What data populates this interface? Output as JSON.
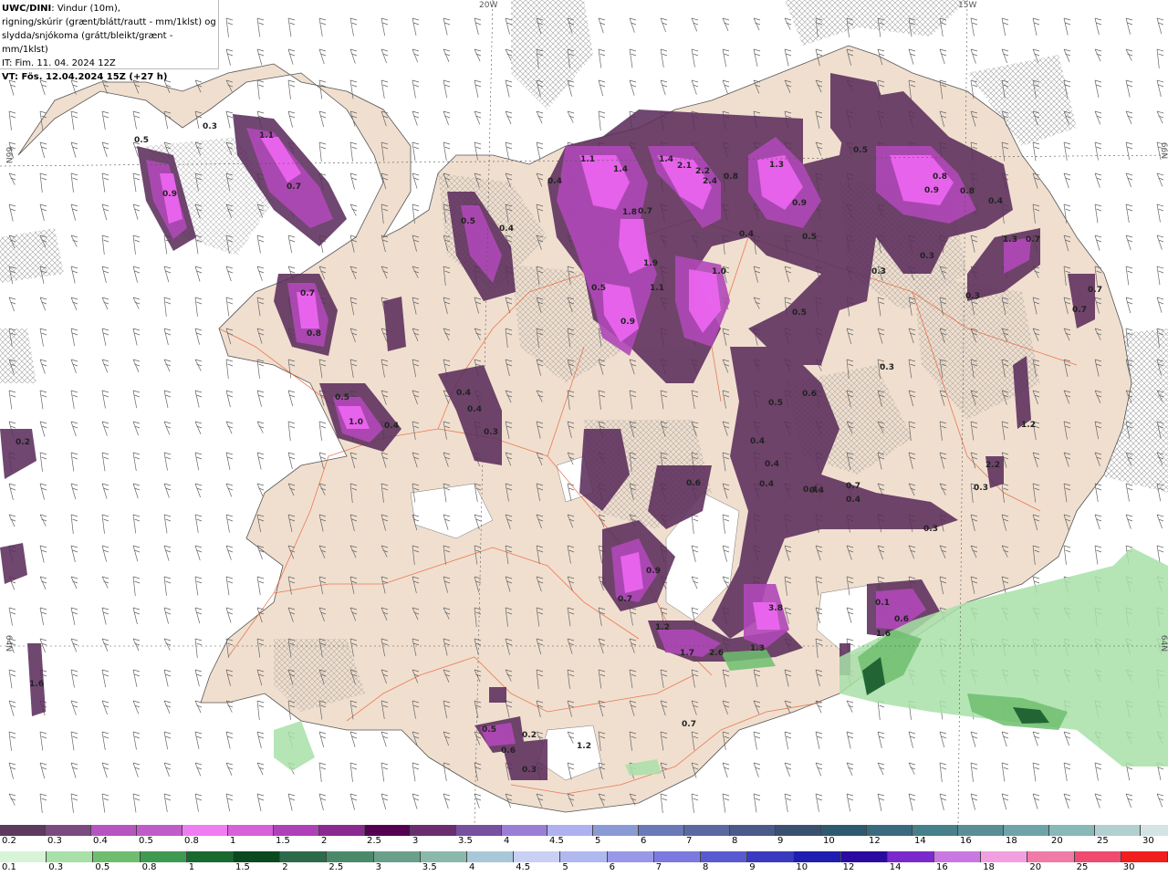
{
  "header": {
    "model": "UWC/DINI",
    "line1_rest": ": Vindur (10m),",
    "line2": "rigning/skúrir (grænt/blátt/rautt - mm/1klst) og",
    "line3": "slydda/snjókoma (grátt/bleikt/grænt - mm/1klst)",
    "line4": "IT: Fim. 11. 04. 2024 12Z",
    "line5": "VT: Fös. 12.04.2024 15Z (+27 h)"
  },
  "grid_labels": {
    "lon_20w": "20W",
    "lon_15w": "15W",
    "lat_66n_left": "66N",
    "lat_66n_right": "66N",
    "lat_64n_left": "64N",
    "lat_64n_right": "64N"
  },
  "colors": {
    "sea": "#ffffff",
    "land": "#f0dfcf",
    "roads": "#e8572a",
    "snow_light": "#5c2e5c",
    "snow_mid": "#b048b8",
    "snow_high": "#ee66f2",
    "rain_light": "#a8e0a8",
    "rain_mid": "#3e9a56",
    "rain_high": "#1a5a2e",
    "barbs": "#666666"
  },
  "legend_snow": {
    "ticks": [
      "0.2",
      "0.3",
      "0.4",
      "0.5",
      "0.8",
      "1",
      "1.5",
      "2",
      "2.5",
      "3",
      "3.5",
      "4",
      "4.5",
      "5",
      "6",
      "7",
      "8",
      "9",
      "10",
      "12",
      "14",
      "16",
      "18",
      "20",
      "25",
      "30"
    ],
    "colors": [
      "#5c3b5e",
      "#7a4a80",
      "#b654c0",
      "#c05cc8",
      "#f07cf2",
      "#d860d8",
      "#b040b8",
      "#8a2a90",
      "#560054",
      "#6a2e70",
      "#7850a0",
      "#9a7ed6",
      "#aeb0f0",
      "#8a9ad4",
      "#6a7ab8",
      "#5a6aa0",
      "#4a5a8a",
      "#3a5070",
      "#2e5a70",
      "#3a6a80",
      "#46808a",
      "#5a8e96",
      "#6ea4a8",
      "#88b8b8",
      "#b2d0d0",
      "#d4e4e4"
    ]
  },
  "legend_rain": {
    "ticks": [
      "0.1",
      "0.3",
      "0.5",
      "0.8",
      "1",
      "1.5",
      "2",
      "2.5",
      "3",
      "3.5",
      "4",
      "4.5",
      "5",
      "6",
      "7",
      "8",
      "9",
      "10",
      "12",
      "14",
      "16",
      "18",
      "20",
      "25",
      "30"
    ],
    "colors": [
      "#d8f4d8",
      "#a8e0a8",
      "#6fbe6f",
      "#3e9a50",
      "#1a6a30",
      "#0a4a1e",
      "#2e6a4a",
      "#4a8a6a",
      "#6aa08a",
      "#8ab8aa",
      "#a8c8d8",
      "#c8d0f4",
      "#b0b8f0",
      "#9898e8",
      "#7a7ae0",
      "#5a5ad0",
      "#3a3ac0",
      "#1e1eb0",
      "#2a0aa0",
      "#7a2acc",
      "#c878e0",
      "#f0a0e0",
      "#f07aa8",
      "#f04a70",
      "#f01e1e"
    ]
  },
  "precip_labels": [
    {
      "t": "0.3"
    },
    {
      "t": "1.1"
    },
    {
      "t": "0.7"
    },
    {
      "t": "0.5"
    },
    {
      "t": "0.9"
    },
    {
      "t": "0.7"
    },
    {
      "t": "0.8"
    },
    {
      "t": "1.0"
    },
    {
      "t": "0.4"
    },
    {
      "t": "0.5"
    },
    {
      "t": "0.4"
    },
    {
      "t": "0.4"
    },
    {
      "t": "0.3"
    },
    {
      "t": "0.5"
    },
    {
      "t": "0.4"
    },
    {
      "t": "0.2"
    },
    {
      "t": "1.1"
    },
    {
      "t": "1.4"
    },
    {
      "t": "1.4"
    },
    {
      "t": "2.1"
    },
    {
      "t": "2.2"
    },
    {
      "t": "2.4"
    },
    {
      "t": "1.8"
    },
    {
      "t": "1.9"
    },
    {
      "t": "1.1"
    },
    {
      "t": "1.0"
    },
    {
      "t": "0.9"
    },
    {
      "t": "0.5"
    },
    {
      "t": "0.4"
    },
    {
      "t": "1.3"
    },
    {
      "t": "0.9"
    },
    {
      "t": "0.7"
    },
    {
      "t": "0.4"
    },
    {
      "t": "0.5"
    },
    {
      "t": "0.5"
    },
    {
      "t": "0.8"
    },
    {
      "t": "0.9"
    },
    {
      "t": "0.8"
    },
    {
      "t": "0.8"
    },
    {
      "t": "0.4"
    },
    {
      "t": "0.3"
    },
    {
      "t": "0.3"
    },
    {
      "t": "0.7"
    },
    {
      "t": "0.3"
    },
    {
      "t": "0.5"
    },
    {
      "t": "0.3"
    },
    {
      "t": "0.6"
    },
    {
      "t": "0.5"
    },
    {
      "t": "0.4"
    },
    {
      "t": "0.4"
    },
    {
      "t": "0.4"
    },
    {
      "t": "0.4"
    },
    {
      "t": "0.6"
    },
    {
      "t": "0.9"
    },
    {
      "t": "0.7"
    },
    {
      "t": "1.2"
    },
    {
      "t": "1.7"
    },
    {
      "t": "2.6"
    },
    {
      "t": "1.3"
    },
    {
      "t": "3.8"
    },
    {
      "t": "1.6"
    },
    {
      "t": "0.6"
    },
    {
      "t": "0.7"
    },
    {
      "t": "0.5"
    },
    {
      "t": "0.2"
    },
    {
      "t": "0.3"
    },
    {
      "t": "0.6"
    },
    {
      "t": "1.2"
    },
    {
      "t": "0.1"
    },
    {
      "t": "1.6"
    },
    {
      "t": "1.3"
    },
    {
      "t": "0.7"
    },
    {
      "t": "2.2"
    },
    {
      "t": "1.2"
    },
    {
      "t": "0.3"
    },
    {
      "t": "0.7"
    },
    {
      "t": "0.4"
    },
    {
      "t": "0.4"
    },
    {
      "t": "0.7"
    },
    {
      "t": "0.3"
    }
  ]
}
